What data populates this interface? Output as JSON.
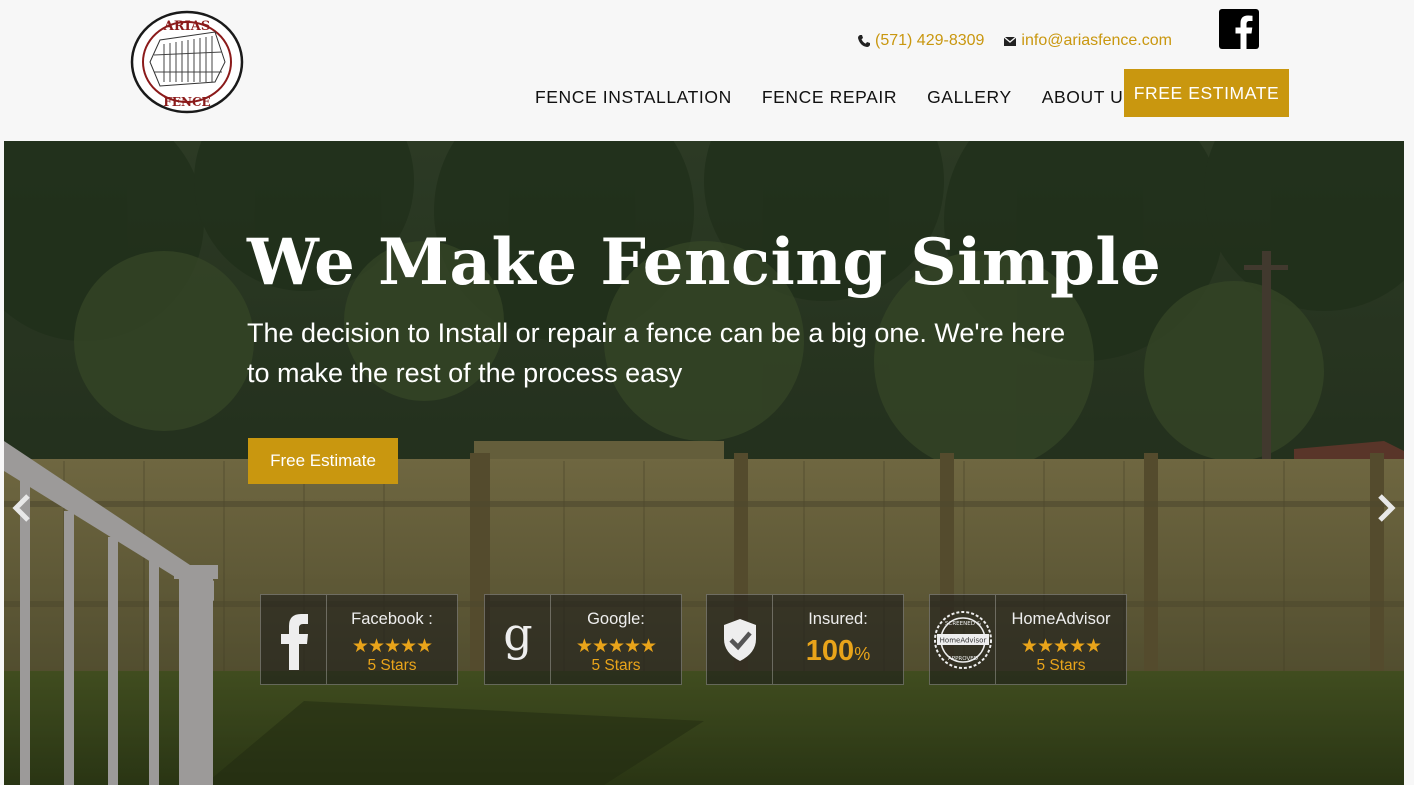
{
  "header": {
    "logo_top": "ARIAS",
    "logo_bottom": "FENCE",
    "phone": "(571) 429-8309",
    "email": "info@ariasfence.com",
    "nav": [
      {
        "label": "FENCE INSTALLATION"
      },
      {
        "label": "FENCE REPAIR"
      },
      {
        "label": "GALLERY"
      },
      {
        "label": "ABOUT US"
      }
    ],
    "cta": "FREE ESTIMATE"
  },
  "hero": {
    "title": "We Make Fencing Simple",
    "subtitle": "The decision to Install or repair a fence can be a big one. We're here to make the rest of the process easy",
    "button": "Free Estimate",
    "badges": [
      {
        "label": "Facebook :",
        "stars": "★★★★★",
        "sub": "5 Stars",
        "icon": "facebook-f-icon"
      },
      {
        "label": "Google:",
        "stars": "★★★★★",
        "sub": "5 Stars",
        "icon": "google-g-icon"
      },
      {
        "label": "Insured:",
        "value": "100",
        "unit": "%",
        "icon": "shield-check-icon"
      },
      {
        "label": "HomeAdvisor",
        "stars": "★★★★★",
        "sub": "5 Stars",
        "icon": "homeadvisor-seal-icon",
        "seal_top": "SCREENED &",
        "seal_mid": "HomeAdvisor",
        "seal_bottom": "APPROVED"
      }
    ]
  },
  "colors": {
    "accent": "#c9970f",
    "star": "#e9a41a",
    "text_dark": "#111111"
  }
}
